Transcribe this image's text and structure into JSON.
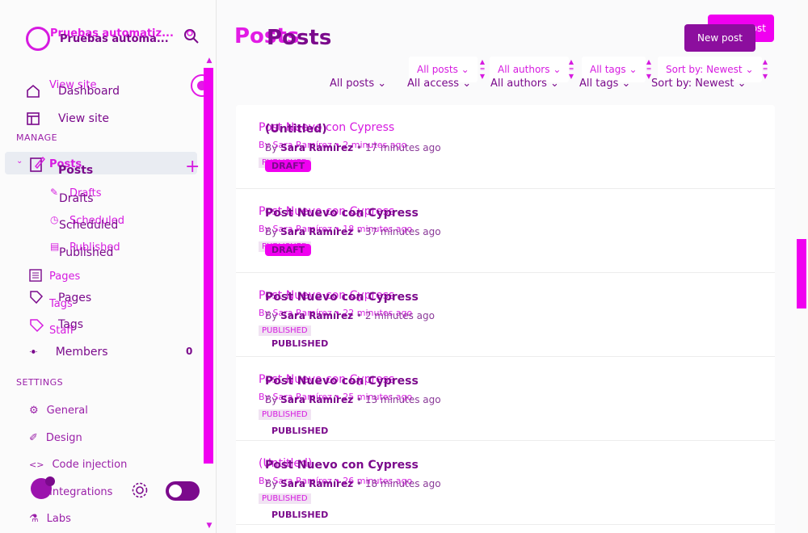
{
  "sidebar": {
    "site_title": "Pruebas automatiz...",
    "site_title_main": "Pruebas automa...",
    "nav_top": [
      {
        "label": "Dashboard",
        "ghost": "View site"
      },
      {
        "label": "View site"
      }
    ],
    "manage_label": "MANAGE",
    "posts_label": "Posts",
    "posts_ghost": "Posts",
    "sub_items": [
      {
        "label": "Drafts",
        "ghost": "Drafts"
      },
      {
        "label": "Scheduled",
        "ghost": "Scheduled"
      },
      {
        "label": "Published",
        "ghost": "Published"
      }
    ],
    "pages_ghost": "Pages",
    "tags_ghost": "Tags",
    "staff_ghost": "Staff",
    "pages_label": "Pages",
    "tags_label": "Tags",
    "members_label": "Members",
    "members_count": "0",
    "settings_label": "SETTINGS",
    "settings_items": [
      {
        "label": "General"
      },
      {
        "label": "Design"
      },
      {
        "label": "Code injection"
      },
      {
        "label": "Integrations"
      },
      {
        "label": "Labs"
      }
    ]
  },
  "header": {
    "title": "Posts",
    "title_ghost": "Posts",
    "new_post": "New post",
    "new_post_ghost": "ost"
  },
  "filters_ghost": [
    "All posts",
    "All authors",
    "All tags",
    "Sort by: Newest"
  ],
  "filters": [
    "All posts",
    "All access",
    "All authors",
    "All tags",
    "Sort by: Newest"
  ],
  "posts": [
    {
      "ghost_title": "Post Nuevo con Cypress",
      "ghost_meta": "By Sara Ramírez • 2 minutes ago",
      "ghost_badge": "PUBLISHED",
      "title": "(Untitled)",
      "author": "Sara Ramírez",
      "time": "17 minutes ago",
      "status": "DRAFT",
      "by": "By"
    },
    {
      "ghost_title": "Post Nuevo con Cypress",
      "ghost_meta": "By Sara Ramírez • 18 minutes ago",
      "ghost_badge": "PUBLISHED",
      "title": "Post Nuevo con Cypress",
      "author": "Sara Ramírez",
      "time": "37 minutes ago",
      "status": "DRAFT",
      "by": "By"
    },
    {
      "ghost_title": "Post Nuevo con Cypress",
      "ghost_meta": "By Sara Ramírez • 22 minutes ago",
      "ghost_badge": "PUBLISHED",
      "title": "Post Nuevo con Cypress",
      "author": "Sara Ramírez",
      "time": "2 minutes ago",
      "status": "PUBLISHED",
      "by": "By"
    },
    {
      "ghost_title": "Post Nuevo con Cypress",
      "ghost_meta": "By Sara Ramírez • 25 minutes ago",
      "ghost_badge": "PUBLISHED",
      "title": "Post Nuevo con Cypress",
      "author": "Sara Ramírez",
      "time": "13 minutes ago",
      "status": "PUBLISHED",
      "by": "By"
    },
    {
      "ghost_title": "(Untitled)",
      "ghost_meta": "By Sara Ramírez • 26 minutes ago",
      "ghost_badge": "PUBLISHED",
      "title": "Post Nuevo con Cypress",
      "author": "Sara Ramírez",
      "time": "18 minutes ago",
      "status": "PUBLISHED",
      "by": "By"
    }
  ],
  "colors": {
    "accent": "#f000f0",
    "primary": "#7b0a8c",
    "ghost": "#d61be0"
  },
  "icons": [
    "search-icon",
    "home-icon",
    "window-icon",
    "pencil-icon",
    "clock-icon",
    "document-icon",
    "pages-icon",
    "tag-icon",
    "members-icon",
    "gear-icon",
    "brush-icon",
    "code-icon",
    "plug-icon",
    "flask-icon",
    "plus-icon"
  ]
}
